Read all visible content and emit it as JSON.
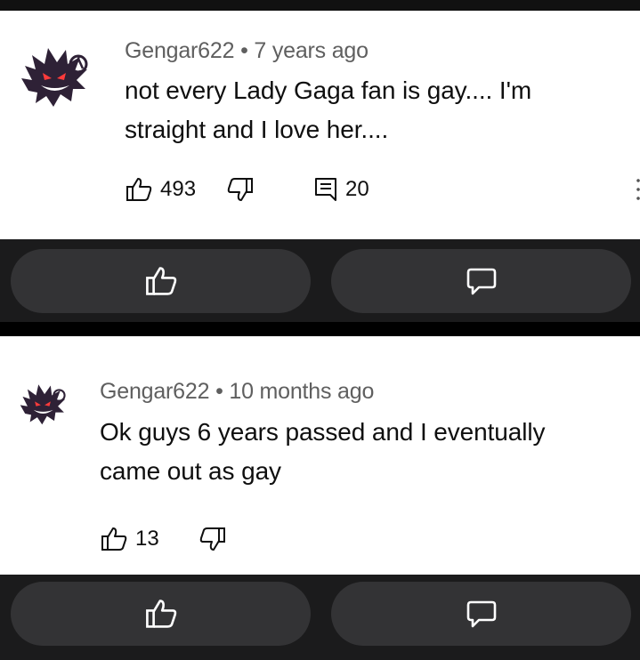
{
  "comments": [
    {
      "author": "Gengar622",
      "separator": "•",
      "time": "7 years ago",
      "text_line1": "not every Lady Gaga fan is gay.... I'm",
      "text_line2": "straight and I love her....",
      "likes": "493",
      "replies": "20"
    },
    {
      "author": "Gengar622",
      "separator": "•",
      "time": "10 months ago",
      "text_line1": "Ok guys 6 years passed and I eventually",
      "text_line2": "came out as gay",
      "likes": "13"
    }
  ],
  "icons": {
    "like": "thumb-up-icon",
    "dislike": "thumb-down-icon",
    "reply": "comment-icon",
    "bubble": "speech-bubble-icon",
    "more": "more-vertical-icon"
  },
  "colors": {
    "meta": "#5f5f5f",
    "text": "#0f0f0f",
    "bar": "#1b1b1c",
    "pill": "#333335"
  }
}
